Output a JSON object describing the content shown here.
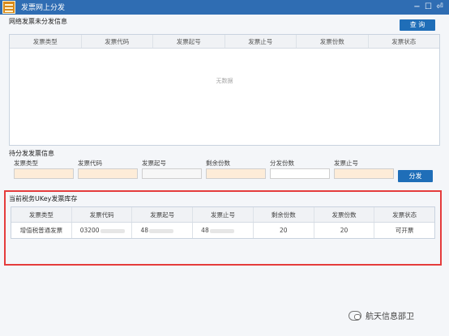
{
  "window": {
    "title": "发票网上分发",
    "buttons": [
      "−",
      "☐",
      "⏎"
    ]
  },
  "undistributed": {
    "title": "网络发票未分发信息",
    "query_label": "查 询",
    "columns": [
      "发票类型",
      "发票代码",
      "发票起号",
      "发票止号",
      "发票份数",
      "发票状态"
    ],
    "empty_text": "无数据"
  },
  "pending": {
    "title": "待分发发票信息",
    "fields": [
      {
        "label": "发票类型",
        "value": ""
      },
      {
        "label": "发票代码",
        "value": ""
      },
      {
        "label": "发票起号",
        "value": ""
      },
      {
        "label": "剩余份数",
        "value": ""
      },
      {
        "label": "分发份数",
        "value": ""
      },
      {
        "label": "发票止号",
        "value": ""
      }
    ],
    "dispatch_label": "分发"
  },
  "stock": {
    "title": "当前税务UKey发票库存",
    "columns": [
      "发票类型",
      "发票代码",
      "发票起号",
      "发票止号",
      "剩余份数",
      "发票份数",
      "发票状态"
    ],
    "rows": [
      [
        "增值税普通发票",
        "03200",
        "48",
        "48",
        "20",
        "20",
        "可开票"
      ]
    ]
  },
  "watermark": "航天信息邵卫"
}
